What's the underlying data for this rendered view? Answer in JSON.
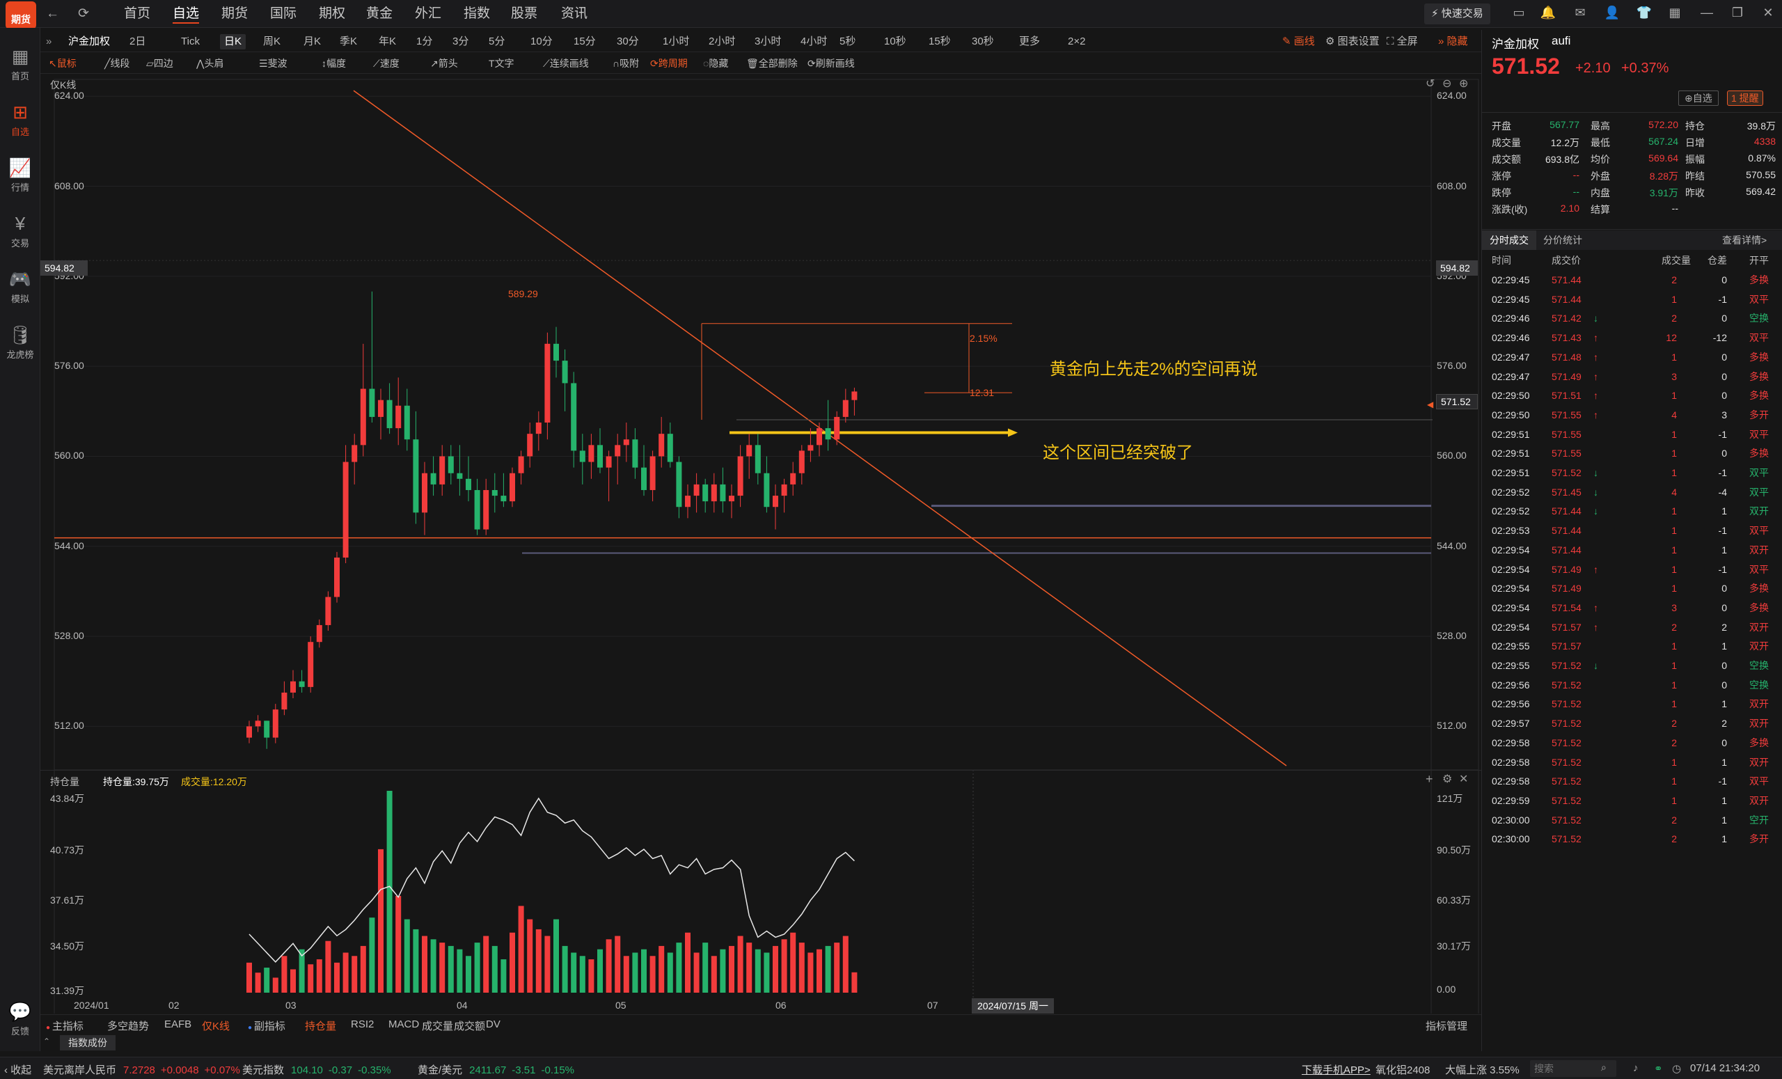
{
  "app": {
    "logo_text": "期货"
  },
  "nav": {
    "items": [
      "首页",
      "自选",
      "期货",
      "国际",
      "期权",
      "黄金",
      "外汇",
      "指数",
      "股票",
      "资讯"
    ],
    "active": "自选",
    "quick_trade": "快速交易"
  },
  "sidebar": {
    "items": [
      {
        "label": "首页",
        "icon": "grid-icon"
      },
      {
        "label": "自选",
        "icon": "add-square-icon"
      },
      {
        "label": "行情",
        "icon": "chart-icon"
      },
      {
        "label": "交易",
        "icon": "yen-icon"
      },
      {
        "label": "模拟",
        "icon": "gamepad-icon"
      },
      {
        "label": "龙虎榜",
        "icon": "database-icon"
      }
    ],
    "feedback": "反馈"
  },
  "periodbar": {
    "symbol": "沪金加权",
    "items": [
      "2日",
      "Tick",
      "日K",
      "周K",
      "月K",
      "季K",
      "年K",
      "1分",
      "3分",
      "5分",
      "10分",
      "15分",
      "30分",
      "1小时",
      "2小时",
      "3小时",
      "4小时",
      "5秒",
      "10秒",
      "15秒",
      "30秒",
      "更多",
      "2×2"
    ],
    "active": "日K",
    "right": [
      "画线",
      "图表设置",
      "全屏",
      "隐藏"
    ]
  },
  "drawbar": {
    "items": [
      "鼠标",
      "线段",
      "四边",
      "头肩",
      "斐波",
      "幅度",
      "速度",
      "箭头",
      "文字",
      "连续画线",
      "吸附",
      "跨周期",
      "隐藏",
      "全部删除",
      "刷新画线"
    ]
  },
  "chart": {
    "label": "仅K线",
    "y_ticks": [
      "624.00",
      "608.00",
      "592.00",
      "576.00",
      "560.00",
      "544.00",
      "528.00",
      "512.00"
    ],
    "crosshair_price": "594.82",
    "current_price_tag": "571.52",
    "high_label": "589.29",
    "fib_top_pct": "2.15%",
    "fib_mid_value": "12.31",
    "annotation_1": "黄金向上先走2%的空间再说",
    "annotation_2": "这个区间已经突破了"
  },
  "subchart": {
    "title": "持仓量",
    "oi_label": "持仓量:39.75万",
    "vol_label": "成交量:12.20万",
    "left_ticks": [
      "43.84万",
      "40.73万",
      "37.61万",
      "34.50万",
      "31.39万"
    ],
    "right_ticks": [
      "121万",
      "90.50万",
      "60.33万",
      "30.17万",
      "0.00"
    ],
    "x_ticks": [
      "2024/01",
      "02",
      "03",
      "04",
      "05",
      "06",
      "07"
    ],
    "date_tag": "2024/07/15 周一"
  },
  "indicators": {
    "items": [
      "主指标",
      "多空趋势",
      "EAFB",
      "仅K线",
      "副指标",
      "持仓量",
      "RSI2",
      "MACD",
      "成交量",
      "成交额",
      "DV"
    ],
    "manage": "指标管理",
    "tab": "指数成份"
  },
  "quote": {
    "name": "沪金加权",
    "code": "aufi",
    "price": "571.52",
    "change": "+2.10",
    "change_pct": "+0.37%",
    "watch": "自选",
    "alert": "1 提醒",
    "rows": [
      [
        [
          "开盘",
          "567.77",
          "green"
        ],
        [
          "最高",
          "572.20",
          "red"
        ],
        [
          "持仓",
          "39.8万",
          "white"
        ]
      ],
      [
        [
          "成交量",
          "12.2万",
          "white"
        ],
        [
          "最低",
          "567.24",
          "green"
        ],
        [
          "日增",
          "4338",
          "red"
        ]
      ],
      [
        [
          "成交额",
          "693.8亿",
          "white"
        ],
        [
          "均价",
          "569.64",
          "red"
        ],
        [
          "振幅",
          "0.87%",
          "white"
        ]
      ],
      [
        [
          "涨停",
          "--",
          "red"
        ],
        [
          "外盘",
          "8.28万",
          "red"
        ],
        [
          "昨结",
          "570.55",
          "white"
        ]
      ],
      [
        [
          "跌停",
          "--",
          "green"
        ],
        [
          "内盘",
          "3.91万",
          "green"
        ],
        [
          "昨收",
          "569.42",
          "white"
        ]
      ],
      [
        [
          "涨跌(收)",
          "2.10",
          "red"
        ],
        [
          "结算",
          "--",
          "white"
        ],
        [
          "",
          "",
          ""
        ]
      ]
    ]
  },
  "trades": {
    "tabs": [
      "分时成交",
      "分价统计"
    ],
    "detail": "查看详情>",
    "headers": [
      "时间",
      "成交价",
      "成交量",
      "仓差",
      "开平"
    ],
    "rows": [
      [
        "02:29:45",
        "571.44",
        "",
        "2",
        "0",
        "多换",
        "r",
        "r",
        "r"
      ],
      [
        "02:29:45",
        "571.44",
        "",
        "1",
        "-1",
        "双平",
        "r",
        "r",
        "r"
      ],
      [
        "02:29:46",
        "571.42",
        "↓",
        "2",
        "0",
        "空换",
        "r",
        "g",
        "g"
      ],
      [
        "02:29:46",
        "571.43",
        "↑",
        "12",
        "-12",
        "双平",
        "r",
        "r",
        "r"
      ],
      [
        "02:29:47",
        "571.48",
        "↑",
        "1",
        "0",
        "多换",
        "r",
        "r",
        "r"
      ],
      [
        "02:29:47",
        "571.49",
        "↑",
        "3",
        "0",
        "多换",
        "r",
        "r",
        "r"
      ],
      [
        "02:29:50",
        "571.51",
        "↑",
        "1",
        "0",
        "多换",
        "r",
        "r",
        "r"
      ],
      [
        "02:29:50",
        "571.55",
        "↑",
        "4",
        "3",
        "多开",
        "r",
        "r",
        "r"
      ],
      [
        "02:29:51",
        "571.55",
        "",
        "1",
        "-1",
        "双平",
        "r",
        "r",
        "r"
      ],
      [
        "02:29:51",
        "571.55",
        "",
        "1",
        "0",
        "多换",
        "r",
        "r",
        "r"
      ],
      [
        "02:29:51",
        "571.52",
        "↓",
        "1",
        "-1",
        "双平",
        "r",
        "g",
        "g"
      ],
      [
        "02:29:52",
        "571.45",
        "↓",
        "4",
        "-4",
        "双平",
        "r",
        "g",
        "g"
      ],
      [
        "02:29:52",
        "571.44",
        "↓",
        "1",
        "1",
        "双开",
        "r",
        "g",
        "g"
      ],
      [
        "02:29:53",
        "571.44",
        "",
        "1",
        "-1",
        "双平",
        "r",
        "r",
        "r"
      ],
      [
        "02:29:54",
        "571.44",
        "",
        "1",
        "1",
        "双开",
        "r",
        "r",
        "r"
      ],
      [
        "02:29:54",
        "571.49",
        "↑",
        "1",
        "-1",
        "双平",
        "r",
        "r",
        "r"
      ],
      [
        "02:29:54",
        "571.49",
        "",
        "1",
        "0",
        "多换",
        "r",
        "r",
        "r"
      ],
      [
        "02:29:54",
        "571.54",
        "↑",
        "3",
        "0",
        "多换",
        "r",
        "r",
        "r"
      ],
      [
        "02:29:54",
        "571.57",
        "↑",
        "2",
        "2",
        "双开",
        "r",
        "r",
        "r"
      ],
      [
        "02:29:55",
        "571.57",
        "",
        "1",
        "1",
        "双开",
        "r",
        "r",
        "r"
      ],
      [
        "02:29:55",
        "571.52",
        "↓",
        "1",
        "0",
        "空换",
        "r",
        "g",
        "g"
      ],
      [
        "02:29:56",
        "571.52",
        "",
        "1",
        "0",
        "空换",
        "r",
        "g",
        "g"
      ],
      [
        "02:29:56",
        "571.52",
        "",
        "1",
        "1",
        "双开",
        "r",
        "r",
        "r"
      ],
      [
        "02:29:57",
        "571.52",
        "",
        "2",
        "2",
        "双开",
        "r",
        "r",
        "r"
      ],
      [
        "02:29:58",
        "571.52",
        "",
        "2",
        "0",
        "多换",
        "r",
        "r",
        "r"
      ],
      [
        "02:29:58",
        "571.52",
        "",
        "1",
        "1",
        "双开",
        "r",
        "r",
        "r"
      ],
      [
        "02:29:58",
        "571.52",
        "",
        "1",
        "-1",
        "双平",
        "r",
        "r",
        "r"
      ],
      [
        "02:29:59",
        "571.52",
        "",
        "1",
        "1",
        "双开",
        "r",
        "r",
        "r"
      ],
      [
        "02:30:00",
        "571.52",
        "",
        "2",
        "1",
        "空开",
        "r",
        "g",
        "g"
      ],
      [
        "02:30:00",
        "571.52",
        "",
        "2",
        "1",
        "多开",
        "r",
        "r",
        "r"
      ]
    ]
  },
  "statusbar": {
    "collapse": "收起",
    "items": [
      {
        "name": "美元离岸人民币",
        "price": "7.2728",
        "chg": "+0.0048",
        "pct": "+0.07%",
        "color": "red"
      },
      {
        "name": "美元指数",
        "price": "104.10",
        "chg": "-0.37",
        "pct": "-0.35%",
        "color": "green"
      },
      {
        "name": "黄金/美元",
        "price": "2411.67",
        "chg": "-3.51",
        "pct": "-0.15%",
        "color": "green"
      }
    ],
    "app_link": "下载手机APP>",
    "news_code": "氧化铝2408",
    "news_text": "大幅上涨 3.55%",
    "search_placeholder": "搜索",
    "datetime": "07/14 21:34:20"
  },
  "chart_data": {
    "type": "candlestick",
    "main_ylim": [
      505,
      627
    ],
    "candles": [
      [
        510,
        513,
        509,
        512
      ],
      [
        512,
        514,
        511,
        513
      ],
      [
        513,
        513,
        508,
        510
      ],
      [
        510,
        516,
        509,
        515
      ],
      [
        515,
        520,
        514,
        518
      ],
      [
        518,
        522,
        517,
        520
      ],
      [
        520,
        522,
        518,
        519
      ],
      [
        519,
        528,
        518,
        527
      ],
      [
        527,
        531,
        526,
        530
      ],
      [
        530,
        536,
        529,
        535
      ],
      [
        535,
        543,
        534,
        542
      ],
      [
        542,
        562,
        541,
        559
      ],
      [
        559,
        564,
        555,
        562
      ],
      [
        562,
        580,
        560,
        572
      ],
      [
        572,
        589.29,
        566,
        567
      ],
      [
        567,
        572,
        563,
        570
      ],
      [
        570,
        573,
        564,
        565
      ],
      [
        565,
        574,
        562,
        569
      ],
      [
        569,
        572,
        561,
        563
      ],
      [
        563,
        568,
        548,
        550
      ],
      [
        550,
        559,
        546,
        557
      ],
      [
        557,
        560,
        553,
        555
      ],
      [
        555,
        562,
        553,
        560
      ],
      [
        560,
        562,
        555,
        557
      ],
      [
        557,
        562,
        553,
        556
      ],
      [
        556,
        560,
        552,
        554
      ],
      [
        554,
        556,
        546,
        547
      ],
      [
        547,
        556,
        546,
        554
      ],
      [
        554,
        557,
        550,
        553
      ],
      [
        553,
        557,
        551,
        552
      ],
      [
        552,
        558,
        551,
        557
      ],
      [
        557,
        561,
        555,
        560
      ],
      [
        560,
        566,
        558,
        564
      ],
      [
        564,
        568,
        561,
        566
      ],
      [
        566,
        582,
        563,
        580
      ],
      [
        580,
        583,
        574,
        577
      ],
      [
        577,
        579,
        568,
        573
      ],
      [
        573,
        575,
        558,
        561
      ],
      [
        561,
        564,
        555,
        559
      ],
      [
        559,
        564,
        556,
        562
      ],
      [
        562,
        565,
        557,
        558
      ],
      [
        558,
        561,
        552,
        560
      ],
      [
        560,
        564,
        555,
        562
      ],
      [
        562,
        566,
        559,
        563
      ],
      [
        563,
        565,
        556,
        558
      ],
      [
        558,
        562,
        553,
        554
      ],
      [
        554,
        561,
        552,
        560
      ],
      [
        560,
        567,
        558,
        564
      ],
      [
        564,
        566,
        558,
        559
      ],
      [
        559,
        560,
        549,
        551
      ],
      [
        551,
        555,
        549,
        553
      ],
      [
        553,
        557,
        550,
        555
      ],
      [
        555,
        556,
        550,
        552
      ],
      [
        552,
        557,
        550,
        555
      ],
      [
        555,
        558,
        550,
        552
      ],
      [
        552,
        555,
        549,
        553
      ],
      [
        553,
        562,
        551,
        560
      ],
      [
        560,
        564,
        556,
        562
      ],
      [
        562,
        564,
        555,
        557
      ],
      [
        557,
        560,
        550,
        551
      ],
      [
        551,
        555,
        547,
        553
      ],
      [
        553,
        556,
        550,
        555
      ],
      [
        555,
        559,
        553,
        557
      ],
      [
        557,
        562,
        555,
        561
      ],
      [
        561,
        565,
        559,
        562
      ],
      [
        562,
        566,
        560,
        565
      ],
      [
        565,
        570,
        561,
        563
      ],
      [
        563,
        568,
        562,
        567
      ],
      [
        567,
        572,
        566,
        570
      ],
      [
        570,
        572.2,
        567.24,
        571.52
      ]
    ],
    "open_interest_wan": [
      35.0,
      34.4,
      33.8,
      33.2,
      33.8,
      34.4,
      33.6,
      34.1,
      34.8,
      35.5,
      34.9,
      35.3,
      35.9,
      36.6,
      37.2,
      37.9,
      38.1,
      37.4,
      38.6,
      39.3,
      38.3,
      39.7,
      40.4,
      39.6,
      40.9,
      41.6,
      41.0,
      41.9,
      42.6,
      42.4,
      42.1,
      41.4,
      42.9,
      43.8,
      42.9,
      42.7,
      42.2,
      42.4,
      41.7,
      41.3,
      40.6,
      39.9,
      40.2,
      40.6,
      40.1,
      40.5,
      39.9,
      40.1,
      38.9,
      39.5,
      39.3,
      39.9,
      38.9,
      39.2,
      39.3,
      39.8,
      39.2,
      36.2,
      34.8,
      35.2,
      34.8,
      35.0,
      35.6,
      36.3,
      37.2,
      37.9,
      38.9,
      39.9,
      40.3,
      39.75
    ],
    "volume_wan": [
      18,
      12,
      15,
      9,
      22,
      14,
      26,
      17,
      20,
      31,
      18,
      24,
      22,
      28,
      45,
      86,
      121,
      58,
      44,
      38,
      34,
      32,
      30,
      28,
      26,
      22,
      30,
      34,
      28,
      20,
      36,
      52,
      44,
      38,
      34,
      44,
      28,
      24,
      22,
      20,
      26,
      32,
      34,
      22,
      24,
      26,
      22,
      28,
      24,
      30,
      36,
      24,
      30,
      22,
      26,
      28,
      34,
      30,
      26,
      24,
      28,
      32,
      36,
      30,
      24,
      26,
      28,
      30,
      34,
      12.2
    ]
  }
}
